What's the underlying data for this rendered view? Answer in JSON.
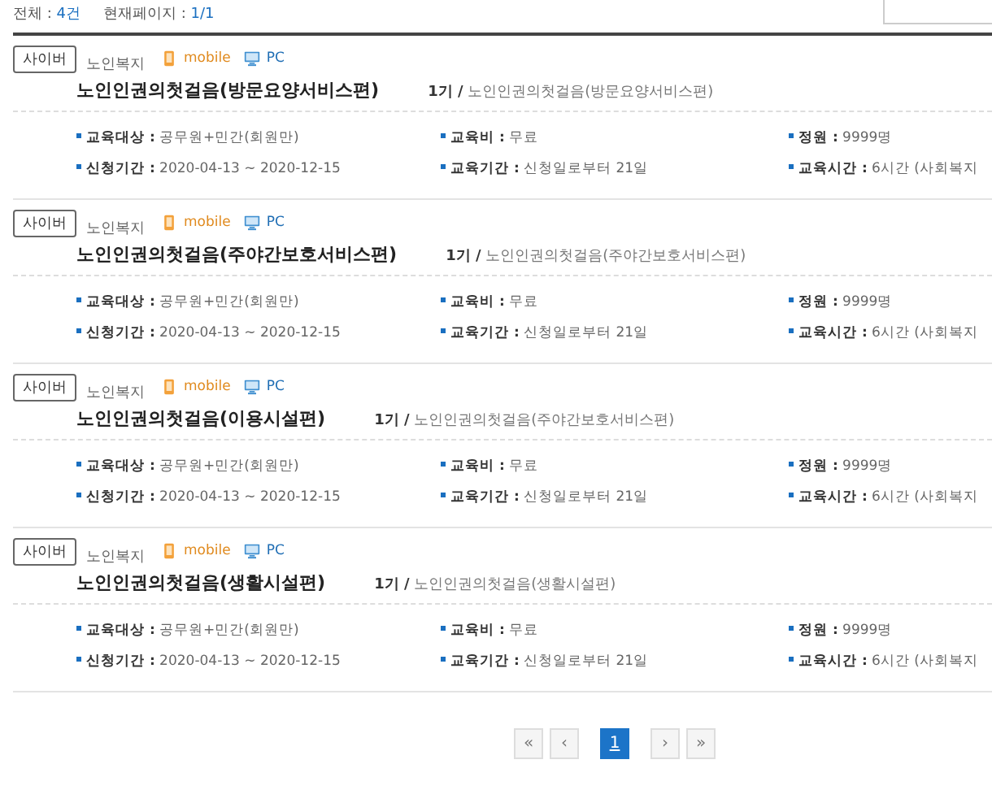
{
  "summary": [
    {
      "label": "전체 : ",
      "value": "4건"
    },
    {
      "label": "현재페이지 : ",
      "value": "1/1"
    }
  ],
  "courses": [
    {
      "badge": "사이버",
      "category": "노인복지",
      "platforms": [
        {
          "kind": "mobile",
          "label": "mobile"
        },
        {
          "kind": "pc",
          "label": "PC"
        }
      ],
      "title": "노인인권의첫걸음(방문요양서비스편)",
      "session": "1기 /",
      "session_name": "노인인권의첫걸음(방문요양서비스편)",
      "info": [
        {
          "label": "교육대상 :",
          "value": "공무원+민간(회원만)"
        },
        {
          "label": "교육비 :",
          "value": "무료"
        },
        {
          "label": "정원 :",
          "value": "9999명"
        },
        {
          "label": "신청기간 :",
          "value": "2020-04-13 ~ 2020-12-15"
        },
        {
          "label": "교육기간 :",
          "value": "신청일로부터 21일"
        },
        {
          "label": "교육시간 :",
          "value": "6시간 (사회복지"
        }
      ]
    },
    {
      "badge": "사이버",
      "category": "노인복지",
      "platforms": [
        {
          "kind": "mobile",
          "label": "mobile"
        },
        {
          "kind": "pc",
          "label": "PC"
        }
      ],
      "title": "노인인권의첫걸음(주야간보호서비스편)",
      "session": "1기 /",
      "session_name": "노인인권의첫걸음(주야간보호서비스편)",
      "info": [
        {
          "label": "교육대상 :",
          "value": "공무원+민간(회원만)"
        },
        {
          "label": "교육비 :",
          "value": "무료"
        },
        {
          "label": "정원 :",
          "value": "9999명"
        },
        {
          "label": "신청기간 :",
          "value": "2020-04-13 ~ 2020-12-15"
        },
        {
          "label": "교육기간 :",
          "value": "신청일로부터 21일"
        },
        {
          "label": "교육시간 :",
          "value": "6시간 (사회복지"
        }
      ]
    },
    {
      "badge": "사이버",
      "category": "노인복지",
      "platforms": [
        {
          "kind": "mobile",
          "label": "mobile"
        },
        {
          "kind": "pc",
          "label": "PC"
        }
      ],
      "title": "노인인권의첫걸음(이용시설편)",
      "session": "1기 /",
      "session_name": "노인인권의첫걸음(주야간보호서비스편)",
      "info": [
        {
          "label": "교육대상 :",
          "value": "공무원+민간(회원만)"
        },
        {
          "label": "교육비 :",
          "value": "무료"
        },
        {
          "label": "정원 :",
          "value": "9999명"
        },
        {
          "label": "신청기간 :",
          "value": "2020-04-13 ~ 2020-12-15"
        },
        {
          "label": "교육기간 :",
          "value": "신청일로부터 21일"
        },
        {
          "label": "교육시간 :",
          "value": "6시간 (사회복지"
        }
      ]
    },
    {
      "badge": "사이버",
      "category": "노인복지",
      "platforms": [
        {
          "kind": "mobile",
          "label": "mobile"
        },
        {
          "kind": "pc",
          "label": "PC"
        }
      ],
      "title": "노인인권의첫걸음(생활시설편)",
      "session": "1기 /",
      "session_name": "노인인권의첫걸음(생활시설편)",
      "info": [
        {
          "label": "교육대상 :",
          "value": "공무원+민간(회원만)"
        },
        {
          "label": "교육비 :",
          "value": "무료"
        },
        {
          "label": "정원 :",
          "value": "9999명"
        },
        {
          "label": "신청기간 :",
          "value": "2020-04-13 ~ 2020-12-15"
        },
        {
          "label": "교육기간 :",
          "value": "신청일로부터 21일"
        },
        {
          "label": "교육시간 :",
          "value": "6시간 (사회복지"
        }
      ]
    }
  ],
  "pagination": [
    {
      "label": "«",
      "selected": false
    },
    {
      "label": "‹",
      "selected": false
    },
    {
      "label": "1",
      "selected": true
    },
    {
      "label": "›",
      "selected": false
    },
    {
      "label": "»",
      "selected": false
    }
  ]
}
